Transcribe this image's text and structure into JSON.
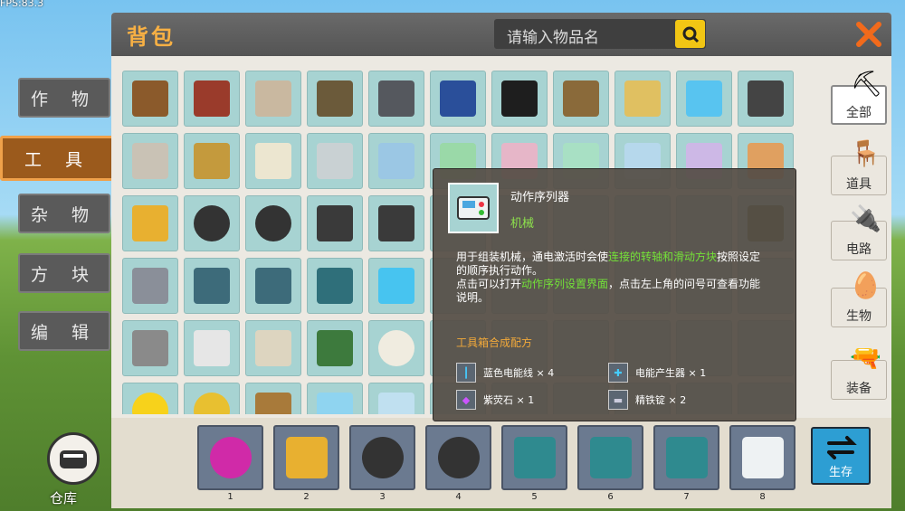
{
  "fps": "FPS:83.3",
  "categories": [
    "作 物",
    "工 具",
    "杂 物",
    "方 块",
    "编 辑"
  ],
  "panel": {
    "title": "背包",
    "search_placeholder": "请输入物品名"
  },
  "filters": [
    {
      "label": "全部",
      "icon": "pickaxe-icon"
    },
    {
      "label": "道具",
      "icon": "stool-icon"
    },
    {
      "label": "电路",
      "icon": "circuit-icon"
    },
    {
      "label": "生物",
      "icon": "egg-icon"
    },
    {
      "label": "装备",
      "icon": "gun-icon"
    }
  ],
  "grid_items": [
    [
      "workbench",
      "furnace",
      "oven",
      "sign-board",
      "stone-table",
      "portal-block",
      "black-block",
      "robot-block",
      "jar-gold",
      "jar-blue",
      "dark-box"
    ],
    [
      "machine-arm",
      "telescope",
      "scroll",
      "glass-gray",
      "glass-blue",
      "glass-green",
      "crystal-pink",
      "crystal-green",
      "crystal-blue",
      "crystal-purple",
      "basket"
    ],
    [
      "console",
      "wheel",
      "wheel",
      "seat-red",
      "seat-red",
      "",
      "",
      "",
      "",
      "",
      "fuel-can"
    ],
    [
      "grabber",
      "joystick",
      "controller",
      "tech-block",
      "ice-cube",
      "",
      "",
      "",
      "",
      "",
      ""
    ],
    [
      "drill",
      "bottle",
      "paper",
      "chip",
      "spotted-egg",
      "",
      "",
      "",
      "",
      "",
      ""
    ],
    [
      "smiley",
      "volleyball",
      "crate",
      "syringe",
      "bottles",
      "",
      "",
      "",
      "",
      "",
      ""
    ]
  ],
  "tooltip": {
    "name": "动作序列器",
    "category": "机械",
    "desc_a": "用于组装机械，通电激活时会使",
    "desc_hl1": "连接的转轴和滑动方块",
    "desc_b": "按照设定的顺序执行动作。",
    "desc_c": "点击可以打开",
    "desc_hl2": "动作序列设置界面",
    "desc_d": "，点击左上角的问号可查看功能说明。",
    "recipe_title": "工具箱合成配方",
    "ingredients": [
      {
        "name": "蓝色电能线",
        "qty": "× 4"
      },
      {
        "name": "电能产生器",
        "qty": "× 1"
      },
      {
        "name": "紫荧石",
        "qty": "× 1"
      },
      {
        "name": "精铁锭",
        "qty": "× 2"
      }
    ]
  },
  "hotbar": [
    {
      "num": "1",
      "item": "pink-blob"
    },
    {
      "num": "2",
      "item": "console"
    },
    {
      "num": "3",
      "item": "wheel"
    },
    {
      "num": "4",
      "item": "wheel"
    },
    {
      "num": "5",
      "item": "teal-block"
    },
    {
      "num": "6",
      "item": "teal-cross-block"
    },
    {
      "num": "7",
      "item": "teal-block"
    },
    {
      "num": "8",
      "item": "action-sequencer"
    }
  ],
  "store_label": "生存",
  "warehouse_label": "仓库",
  "colors": {
    "accent": "#f7b044",
    "cell": "#a7d3d2",
    "highlight": "#73e238",
    "store": "#2d9ed3"
  }
}
